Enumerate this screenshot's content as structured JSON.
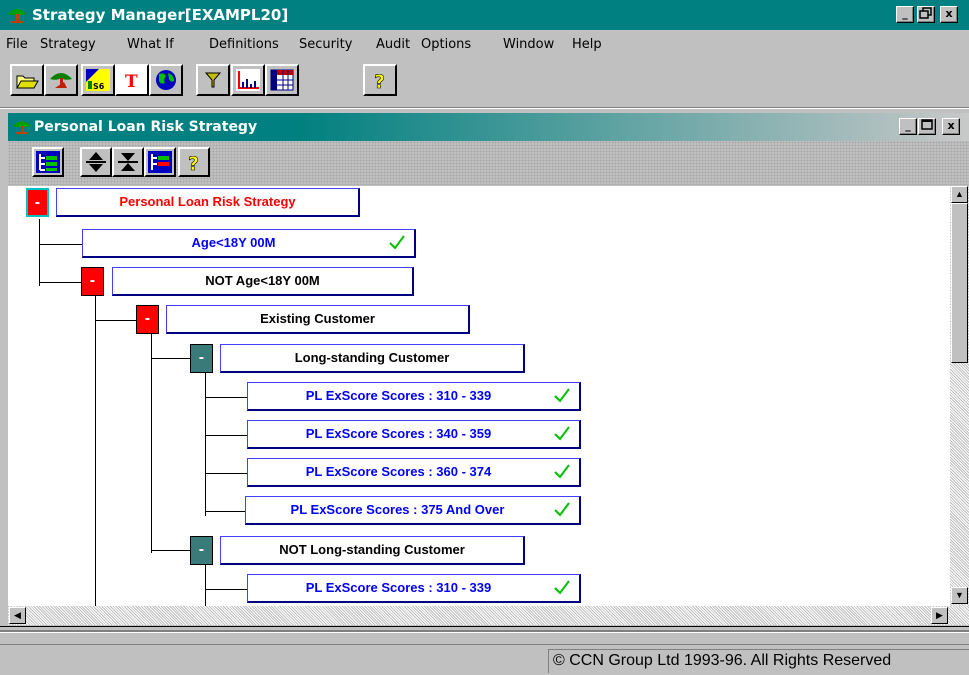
{
  "window": {
    "title": "Strategy Manager[EXAMPL20]",
    "buttons": [
      "_",
      "▫",
      "x"
    ]
  },
  "menu": [
    "File",
    "Strategy",
    "What If",
    "Definitions",
    "Security",
    "Audit",
    "Options",
    "Window",
    "Help"
  ],
  "toolbar_icons": [
    "open-folder-icon",
    "tree-icon",
    "score-icon",
    "text-icon",
    "globe-icon",
    "filter-icon",
    "chart-icon",
    "table-icon",
    "help-icon"
  ],
  "child_window": {
    "title": "Personal Loan Risk Strategy",
    "toolbar_icons": [
      "tree-view-icon",
      "expand-icon",
      "collapse-icon",
      "edit-tree-icon",
      "help-icon"
    ]
  },
  "tree": {
    "root": {
      "toggle": "-",
      "label": "Personal Loan Risk Strategy",
      "color": "#ff0000"
    },
    "nodes": [
      {
        "toggle": "",
        "label": "Age<18Y 00M",
        "checked": true
      },
      {
        "toggle": "-",
        "label": "NOT Age<18Y 00M"
      },
      {
        "toggle": "-",
        "label": "Existing Customer"
      },
      {
        "toggle": "-",
        "label": "Long-standing Customer"
      },
      {
        "label": "PL ExScore Scores : 310 - 339",
        "checked": true
      },
      {
        "label": "PL ExScore Scores : 340 - 359",
        "checked": true
      },
      {
        "label": "PL ExScore Scores : 360 - 374",
        "checked": true
      },
      {
        "label": "PL ExScore Scores : 375 And Over",
        "checked": true
      },
      {
        "toggle": "-",
        "label": "NOT Long-standing Customer"
      },
      {
        "label": "PL ExScore Scores : 310 - 339",
        "checked": true
      }
    ]
  },
  "status": "© CCN Group Ltd 1993-96. All Rights Reserved"
}
